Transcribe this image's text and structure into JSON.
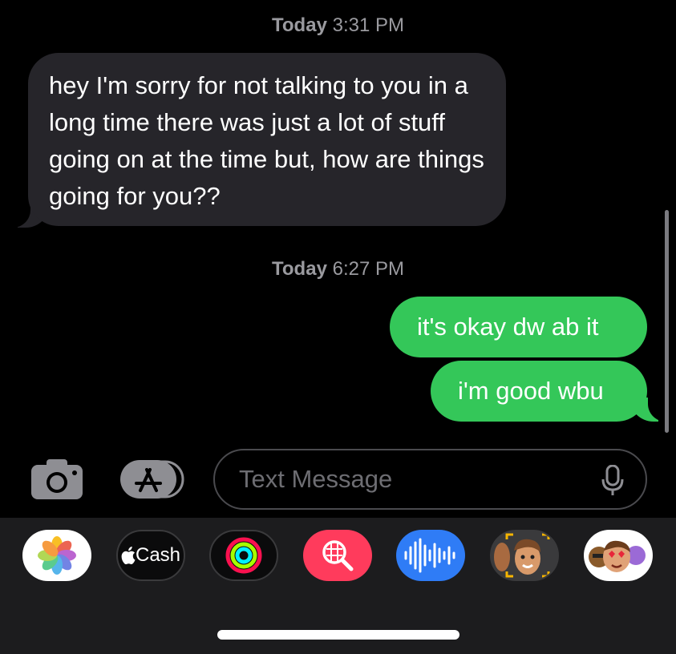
{
  "conversation": {
    "timestamp_1": {
      "day": "Today",
      "time": "3:31 PM"
    },
    "timestamp_2": {
      "day": "Today",
      "time": "6:27 PM"
    },
    "messages": [
      {
        "direction": "incoming",
        "text": "hey I'm sorry for not talking to you in a long time there was just a lot of stuff going on at the time but, how are  things going for you??"
      },
      {
        "direction": "outgoing",
        "text": "it's okay dw ab it"
      },
      {
        "direction": "outgoing",
        "text": "i'm good wbu"
      }
    ]
  },
  "composer": {
    "camera_icon": "camera-icon",
    "apps_icon": "app-store-icon",
    "placeholder": "Text Message",
    "mic_icon": "microphone-icon"
  },
  "app_drawer": {
    "apps": [
      {
        "name": "Photos",
        "icon": "photos-icon"
      },
      {
        "name": "Apple Cash",
        "label": "Cash",
        "icon": "apple-logo-icon"
      },
      {
        "name": "Activity",
        "icon": "activity-rings-icon"
      },
      {
        "name": "Images",
        "icon": "image-search-icon"
      },
      {
        "name": "Audio Message",
        "icon": "waveform-icon"
      },
      {
        "name": "Memoji",
        "icon": "memoji-icon"
      },
      {
        "name": "Memoji Stickers",
        "icon": "memoji-stickers-icon"
      }
    ]
  },
  "colors": {
    "background": "#000000",
    "incoming_bubble": "#26252a",
    "outgoing_bubble": "#34c759",
    "timestamp_text": "#9a9a9f",
    "drawer_background": "#1c1c1e"
  }
}
